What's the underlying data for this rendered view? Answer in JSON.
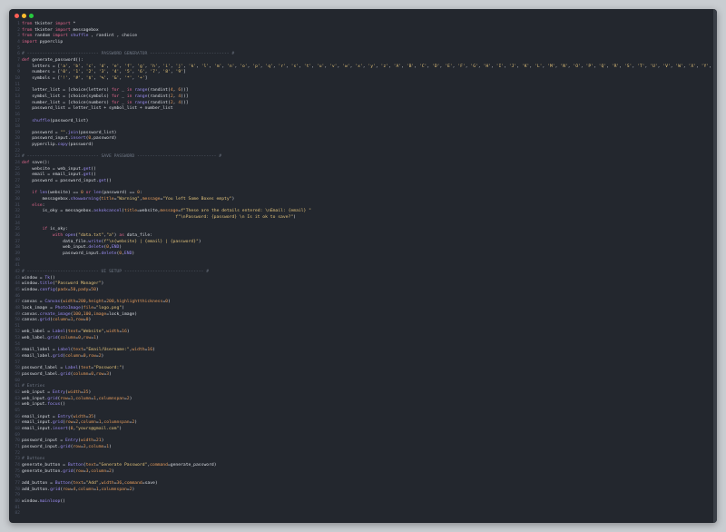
{
  "window": {
    "controls": [
      {
        "name": "close",
        "color": "#ff5f56"
      },
      {
        "name": "minimize",
        "color": "#ffbd2e"
      },
      {
        "name": "maximize",
        "color": "#27c93f"
      }
    ]
  },
  "code_lines": [
    "from tkinter import *",
    "from tkinter import messagebox",
    "from random import shuffle , randint , choice",
    "import pyperclip",
    "",
    "# ---------------------------- PASSWORD GENERATOR ------------------------------- #",
    "def generate_password():",
    "    letters = ['a', 'b', 'c', 'd', 'e', 'f', 'g', 'h', 'i', 'j', 'k', 'l', 'm', 'n', 'o', 'p', 'q', 'r', 's', 't', 'u', 'v', 'w', 'x', 'y', 'z', 'A', 'B', 'C', 'D', 'E', 'F', 'G', 'H', 'I', 'J', 'K', 'L', 'M', 'N', 'O', 'P', 'Q', 'R', 'S', 'T', 'U', 'V', 'W', 'X', 'Y', 'Z']",
    "    numbers = ['0', '1', '2', '3', '4', '5', '6', '7', '8', '9']",
    "    symbols = ['!', '#', '$', '%', '&', '*', '+']",
    "",
    "    letter_list = [choice(letters) for _ in range(randint(4, 6))]",
    "    symbol_list = [choice(symbols) for _ in range(randint(2, 4))]",
    "    number_list = [choice(numbers) for _ in range(randint(2, 4))]",
    "    password_list = letter_list + symbol_list + number_list",
    "",
    "    shuffle(password_list)",
    "",
    "    password = \"\".join(password_list)",
    "    password_input.insert(0,password)",
    "    pyperclip.copy(password)",
    "",
    "# ---------------------------- SAVE PASSWORD ------------------------------- #",
    "def save():",
    "    website = web_input.get()",
    "    email = email_input.get()",
    "    password = password_input.get()",
    "",
    "    if len(website) == 0 or len(password) == 0:",
    "        messagebox.showwarning(title=\"Warning\",message=\"You left Some Boxes empty\")",
    "    else:",
    "        is_oky = messagebox.askokcancel(title=website,message=f\"These are the details entered: \\nEmail: {email} \"",
    "                                                            f\"\\nPassword: {password} \\n Is it ok to save?\")",
    "",
    "        if is_oky:",
    "            with open(\"data.txt\",\"a\") as data_file:",
    "                data_file.write(f\"\\n{website} | {email} | {password}\")",
    "                web_input.delete(0,END)",
    "                password_input.delete(0,END)",
    "",
    "",
    "# ---------------------------- UI SETUP ------------------------------- #",
    "window = Tk()",
    "window.title(\"Password Manager\")",
    "window.config(padx=50,pady=50)",
    "",
    "canvas = Canvas(width=200,height=200,highlightthickness=0)",
    "lock_image = PhotoImage(file=\"logo.png\")",
    "canvas.create_image(100,100,image=lock_image)",
    "canvas.grid(column=1,row=0)",
    "",
    "web_label = Label(text=\"Website\",width=16)",
    "web_label.grid(column=0,row=1)",
    "",
    "email_label = Label(text=\"Email/Username:\",width=16)",
    "email_label.grid(column=0,row=2)",
    "",
    "password_label = Label(text=\"Password:\")",
    "password_label.grid(column=0,row=3)",
    "",
    "# Entries",
    "web_input = Entry(width=35)",
    "web_input.grid(row=1,column=1,columnspan=2)",
    "web_input.focus()",
    "",
    "email_input = Entry(width=35)",
    "email_input.grid(row=2,column=1,columnspan=2)",
    "email_input.insert(0,\"yours@gmail.com\")",
    "",
    "password_input = Entry(width=21)",
    "password_input.grid(row=3,column=1)",
    "",
    "# Buttons",
    "generate_button = Button(text=\"Generate Password\",command=generate_password)",
    "generate_button.grid(row=3,column=2)",
    "",
    "add_button = Button(text=\"Add\",width=36,command=save)",
    "add_button.grid(row=4,column=1,columnspan=2)",
    "",
    "window.mainloop()",
    "",
    ""
  ]
}
